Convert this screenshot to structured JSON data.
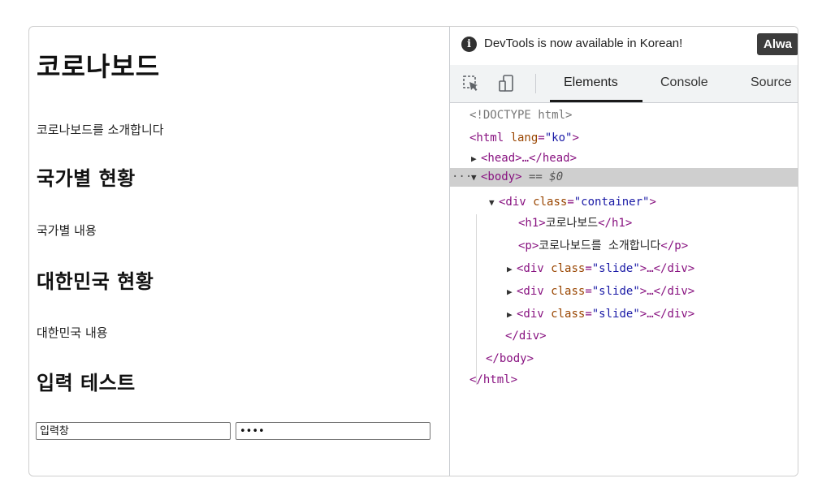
{
  "page": {
    "title": "코로나보드",
    "intro": "코로나보드를 소개합니다",
    "sections": [
      {
        "heading": "국가별 현황",
        "content": "국가별 내용"
      },
      {
        "heading": "대한민국 현황",
        "content": "대한민국 내용"
      },
      {
        "heading": "입력 테스트"
      }
    ],
    "inputs": {
      "text_placeholder": "입력창",
      "password_value": "abcd"
    }
  },
  "devtools": {
    "infobar": {
      "message": "DevTools is now available in Korean!",
      "button_label": "Alwa"
    },
    "tabs": [
      "Elements",
      "Console",
      "Source"
    ],
    "active_tab": "Elements",
    "dom": {
      "doctype": "<!DOCTYPE html>",
      "html_open": "<html ",
      "html_attr": "lang",
      "html_attr_val": "\"ko\"",
      "head": "<head>…</head>",
      "body_open": "<body>",
      "body_eq": " == $0",
      "div_open": "<div ",
      "div_class_attr": "class",
      "div_class_val": "\"container\"",
      "h1_open": "<h1>",
      "h1_text": "코로나보드",
      "h1_close": "</h1>",
      "p_open": "<p>",
      "p_text": "코로나보드를 소개합니다",
      "p_close": "</p>",
      "slide_prefix": "<div ",
      "slide_attr": "class",
      "slide_val": "\"slide\"",
      "slide_suffix": ">…</div>",
      "div_close": "</div>",
      "body_close": "</body>",
      "html_close": "</html>",
      "ellipsis": "···"
    },
    "colors": {
      "tag": "#881280",
      "attr_name": "#994500",
      "attr_value": "#1a1aa6",
      "selected_row": "#cfcfcf",
      "toolbar_bg": "#f1f3f4"
    }
  }
}
